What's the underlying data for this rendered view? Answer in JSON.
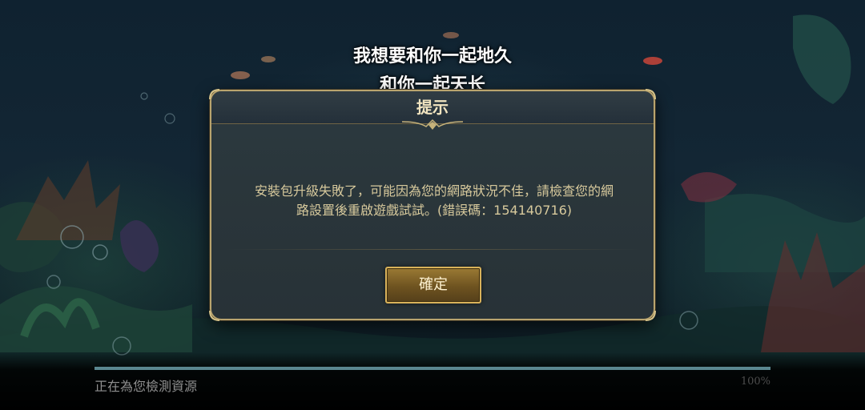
{
  "lyrics": {
    "line1": "我想要和你一起地久",
    "line2": "和你一起天长"
  },
  "dialog": {
    "title": "提示",
    "message_line1": "安裝包升級失敗了，可能因為您的網路狀況不佳，請檢查您的網",
    "message_line2": "路設置後重啟遊戲試試。(錯誤碼：154140716)",
    "confirm_label": "確定"
  },
  "loader": {
    "status": "正在為您檢測資源",
    "percent_label": "100%",
    "progress_fraction": 1.0
  },
  "colors": {
    "accent_gold": "#b9a46e",
    "button_gold": "#d9b25a",
    "message_text": "#d7c99c",
    "progress": "#5a8790"
  }
}
